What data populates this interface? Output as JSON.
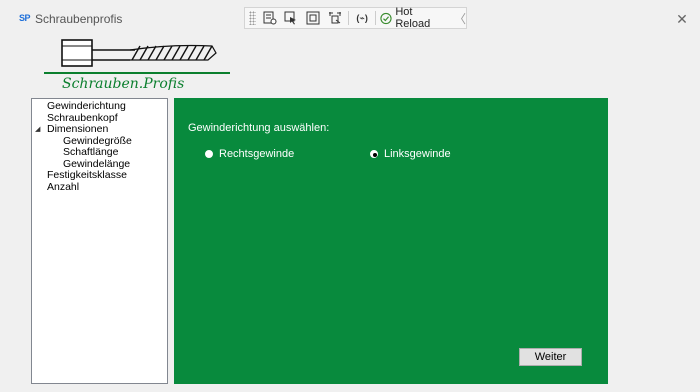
{
  "window": {
    "title": "Schraubenprofis",
    "app_icon_text": "SP",
    "close_label": "✕"
  },
  "debug_toolbar": {
    "hot_reload_label": "Hot Reload",
    "xaml_binding_label": "(⌁)",
    "collapse_label": "〈"
  },
  "logo": {
    "text": "Schrauben.Profis"
  },
  "navigation": {
    "items": [
      {
        "label": "Gewinderichtung",
        "level": 0
      },
      {
        "label": "Schraubenkopf",
        "level": 0
      },
      {
        "label": "Dimensionen",
        "level": 0,
        "expander": "◢"
      },
      {
        "label": "Gewindegröße",
        "level": 1
      },
      {
        "label": "Schaftlänge",
        "level": 1
      },
      {
        "label": "Gewindelänge",
        "level": 1
      },
      {
        "label": "Festigkeitsklasse",
        "level": 0
      },
      {
        "label": "Anzahl",
        "level": 0
      }
    ]
  },
  "content": {
    "background_color": "#088a3d",
    "section_label": "Gewinderichtung auswählen:",
    "options": [
      {
        "label": "Rechtsgewinde",
        "checked": false
      },
      {
        "label": "Linksgewinde",
        "checked": true
      }
    ],
    "next_button_label": "Weiter"
  }
}
